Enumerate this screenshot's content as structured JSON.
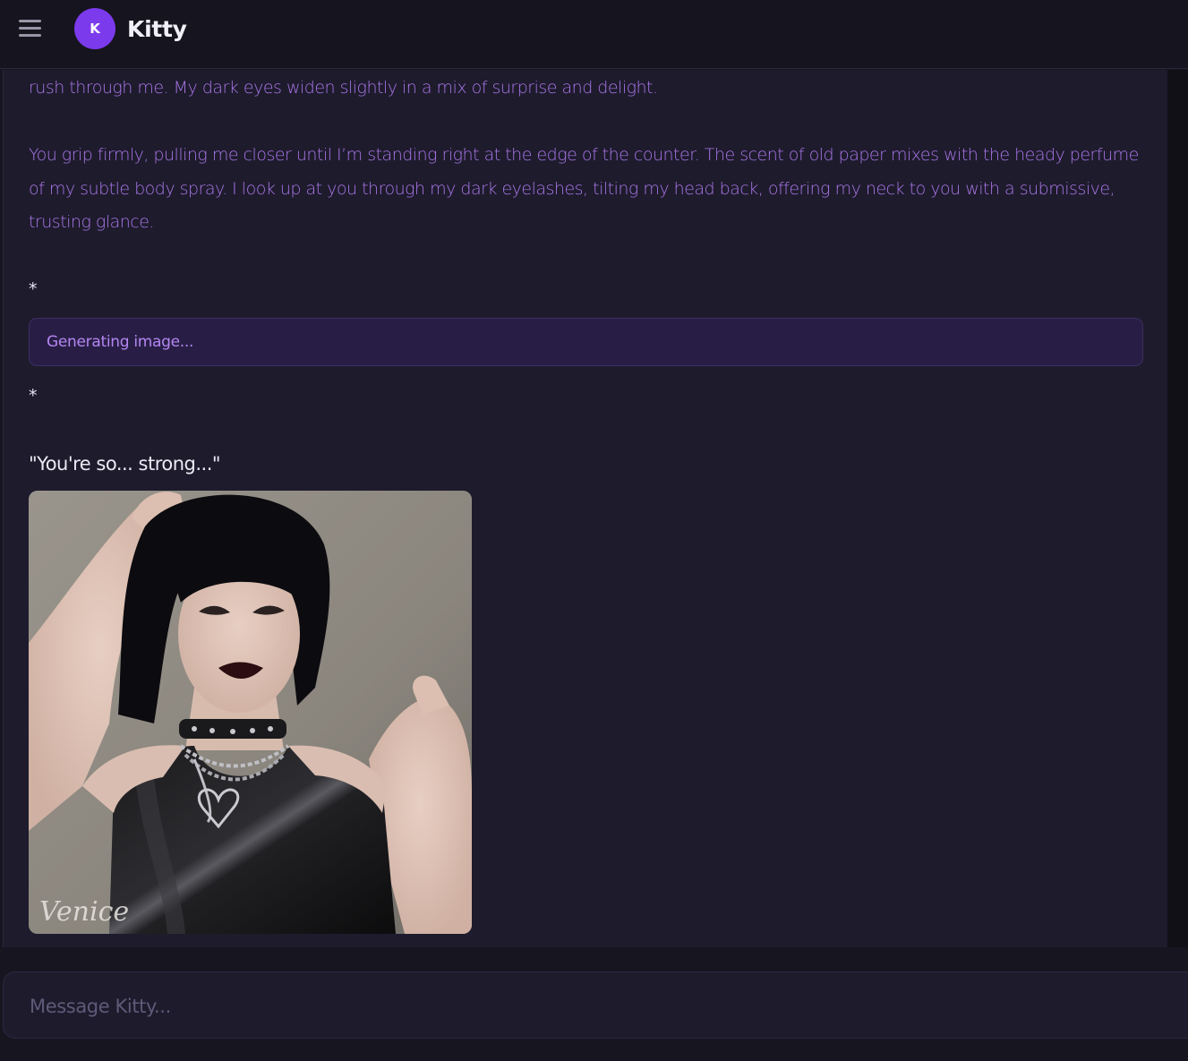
{
  "header": {
    "avatar_initial": "K",
    "title": "Kitty"
  },
  "chat": {
    "paragraph_1": "rush through me. My dark eyes widen slightly in a mix of surprise and delight.",
    "paragraph_2": "You grip firmly, pulling me closer until I’m standing right at the edge of the counter. The scent of old paper mixes with the heady perfume of my subtle body spray. I look up at you through my dark eyelashes, tilting my head back, offering my neck to you with a submissive, trusting glance.",
    "asterisk_top": "*",
    "generating_label": "Generating image...",
    "asterisk_bottom": "*",
    "quote": "\"You're so... strong...\"",
    "image_watermark": "Venice"
  },
  "composer": {
    "placeholder": "Message Kitty..."
  },
  "icons": {
    "menu": "hamburger-menu-icon"
  },
  "colors": {
    "accent": "#7c3aed",
    "message_text": "#a876e6",
    "background": "#1e1b2d"
  }
}
